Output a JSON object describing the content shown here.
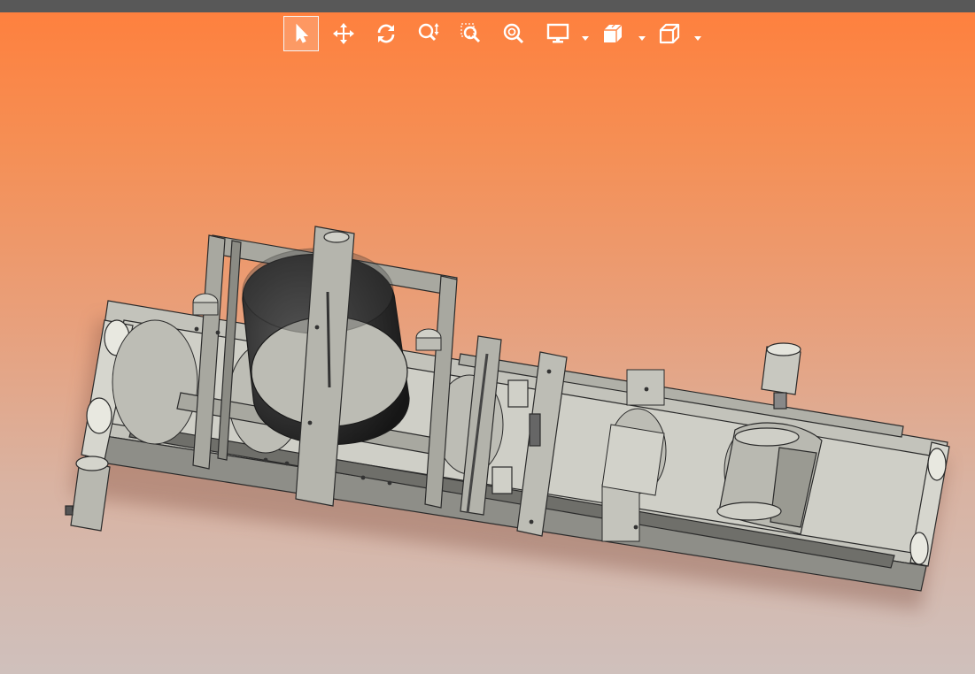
{
  "toolbar": {
    "tools": [
      {
        "name": "select",
        "icon": "pointer-arrow-icon",
        "selected": true
      },
      {
        "name": "pan",
        "icon": "move-arrows-icon"
      },
      {
        "name": "rotate",
        "icon": "rotate-icon"
      },
      {
        "name": "zoom-in-out",
        "icon": "zoom-in-out-icon"
      },
      {
        "name": "zoom-window",
        "icon": "zoom-window-icon"
      },
      {
        "name": "zoom-fit",
        "icon": "zoom-fit-icon"
      },
      {
        "name": "display-mode",
        "icon": "monitor-icon",
        "has_dropdown": true
      },
      {
        "name": "section-view",
        "icon": "section-cube-icon",
        "has_dropdown": true
      },
      {
        "name": "view-orientation",
        "icon": "wireframe-cube-icon",
        "has_dropdown": true
      }
    ]
  },
  "colors": {
    "background_top": "#ff7f3c",
    "background_bottom": "#cfc0bc",
    "title_strip": "#585858",
    "model_gray": "#c8c8c0",
    "model_edge": "#2a2a2a"
  }
}
